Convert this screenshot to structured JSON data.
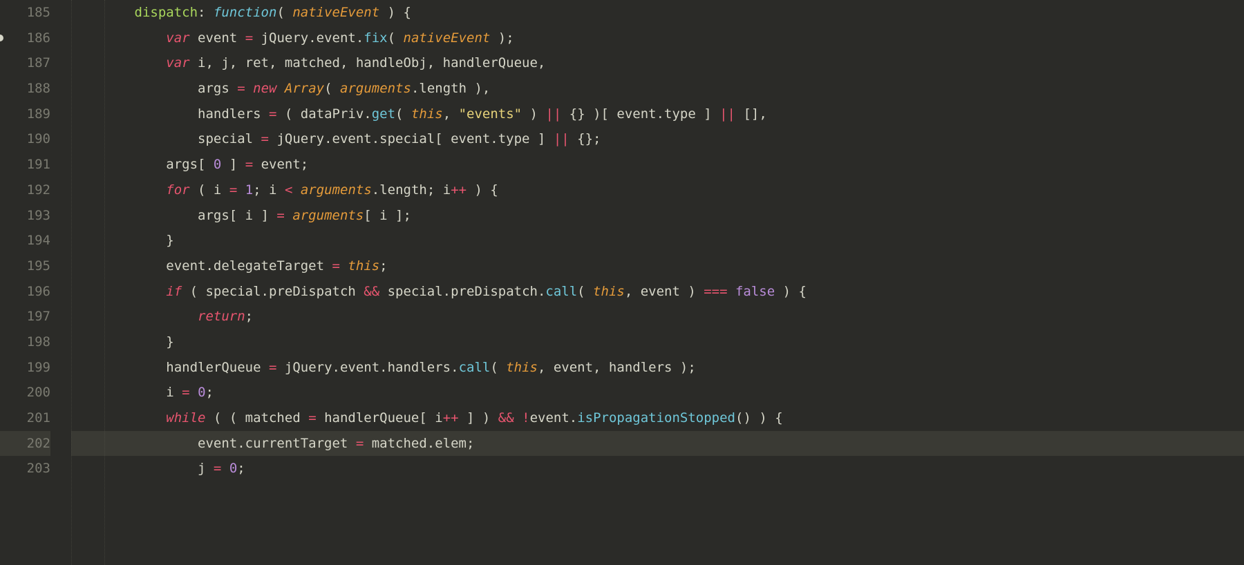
{
  "gutter": {
    "start": 185,
    "end": 203,
    "modified_lines": [
      186
    ],
    "current_line": 202
  },
  "code": {
    "lines": [
      {
        "n": 185,
        "indent": 2,
        "tokens": [
          [
            "def",
            "dispatch"
          ],
          [
            "pu",
            ": "
          ],
          [
            "fn",
            "function"
          ],
          [
            "pu",
            "( "
          ],
          [
            "par",
            "nativeEvent"
          ],
          [
            "pu",
            " ) {"
          ]
        ]
      },
      {
        "n": 186,
        "indent": 3,
        "tokens": [
          [
            "kw",
            "var"
          ],
          [
            "pl",
            " event "
          ],
          [
            "op",
            "="
          ],
          [
            "pl",
            " jQuery.event."
          ],
          [
            "fnn",
            "fix"
          ],
          [
            "pu",
            "( "
          ],
          [
            "par",
            "nativeEvent"
          ],
          [
            "pu",
            " );"
          ]
        ]
      },
      {
        "n": 187,
        "indent": 3,
        "tokens": [
          [
            "kw",
            "var"
          ],
          [
            "pl",
            " i, j, ret, matched, handleObj, handlerQueue,"
          ]
        ]
      },
      {
        "n": 188,
        "indent": 4,
        "tokens": [
          [
            "pl",
            "args "
          ],
          [
            "op",
            "="
          ],
          [
            "pl",
            " "
          ],
          [
            "kw",
            "new"
          ],
          [
            "pl",
            " "
          ],
          [
            "par",
            "Array"
          ],
          [
            "pu",
            "( "
          ],
          [
            "par",
            "arguments"
          ],
          [
            "pl",
            ".length ),"
          ]
        ]
      },
      {
        "n": 189,
        "indent": 4,
        "tokens": [
          [
            "pl",
            "handlers "
          ],
          [
            "op",
            "="
          ],
          [
            "pl",
            " ( dataPriv."
          ],
          [
            "fnn",
            "get"
          ],
          [
            "pu",
            "( "
          ],
          [
            "par",
            "this"
          ],
          [
            "pu",
            ", "
          ],
          [
            "str",
            "\"events\""
          ],
          [
            "pu",
            " ) "
          ],
          [
            "op",
            "||"
          ],
          [
            "pu",
            " {} )[ event.type ] "
          ],
          [
            "op",
            "||"
          ],
          [
            "pu",
            " [],"
          ]
        ]
      },
      {
        "n": 190,
        "indent": 4,
        "tokens": [
          [
            "pl",
            "special "
          ],
          [
            "op",
            "="
          ],
          [
            "pl",
            " jQuery.event.special[ event.type ] "
          ],
          [
            "op",
            "||"
          ],
          [
            "pl",
            " {};"
          ]
        ]
      },
      {
        "n": 191,
        "indent": 3,
        "tokens": [
          [
            "pl",
            "args[ "
          ],
          [
            "num",
            "0"
          ],
          [
            "pl",
            " ] "
          ],
          [
            "op",
            "="
          ],
          [
            "pl",
            " event;"
          ]
        ]
      },
      {
        "n": 192,
        "indent": 3,
        "tokens": [
          [
            "kw",
            "for"
          ],
          [
            "pu",
            " ( i "
          ],
          [
            "op",
            "="
          ],
          [
            "pu",
            " "
          ],
          [
            "num",
            "1"
          ],
          [
            "pu",
            "; i "
          ],
          [
            "op",
            "<"
          ],
          [
            "pu",
            " "
          ],
          [
            "par",
            "arguments"
          ],
          [
            "pl",
            ".length; i"
          ],
          [
            "op",
            "++"
          ],
          [
            "pu",
            " ) {"
          ]
        ]
      },
      {
        "n": 193,
        "indent": 4,
        "tokens": [
          [
            "pl",
            "args[ i ] "
          ],
          [
            "op",
            "="
          ],
          [
            "pl",
            " "
          ],
          [
            "par",
            "arguments"
          ],
          [
            "pl",
            "[ i ];"
          ]
        ]
      },
      {
        "n": 194,
        "indent": 3,
        "tokens": [
          [
            "pu",
            "}"
          ]
        ]
      },
      {
        "n": 195,
        "indent": 3,
        "tokens": [
          [
            "pl",
            "event.delegateTarget "
          ],
          [
            "op",
            "="
          ],
          [
            "pl",
            " "
          ],
          [
            "par",
            "this"
          ],
          [
            "pu",
            ";"
          ]
        ]
      },
      {
        "n": 196,
        "indent": 3,
        "tokens": [
          [
            "kw",
            "if"
          ],
          [
            "pu",
            " ( special.preDispatch "
          ],
          [
            "op",
            "&&"
          ],
          [
            "pu",
            " special.preDispatch."
          ],
          [
            "fnn",
            "call"
          ],
          [
            "pu",
            "( "
          ],
          [
            "par",
            "this"
          ],
          [
            "pu",
            ", event ) "
          ],
          [
            "op",
            "==="
          ],
          [
            "pu",
            " "
          ],
          [
            "bool",
            "false"
          ],
          [
            "pu",
            " ) {"
          ]
        ]
      },
      {
        "n": 197,
        "indent": 4,
        "tokens": [
          [
            "kw",
            "return"
          ],
          [
            "pu",
            ";"
          ]
        ]
      },
      {
        "n": 198,
        "indent": 3,
        "tokens": [
          [
            "pu",
            "}"
          ]
        ]
      },
      {
        "n": 199,
        "indent": 3,
        "tokens": [
          [
            "pl",
            "handlerQueue "
          ],
          [
            "op",
            "="
          ],
          [
            "pl",
            " jQuery.event.handlers."
          ],
          [
            "fnn",
            "call"
          ],
          [
            "pu",
            "( "
          ],
          [
            "par",
            "this"
          ],
          [
            "pu",
            ", event, handlers );"
          ]
        ]
      },
      {
        "n": 200,
        "indent": 3,
        "tokens": [
          [
            "pl",
            "i "
          ],
          [
            "op",
            "="
          ],
          [
            "pl",
            " "
          ],
          [
            "num",
            "0"
          ],
          [
            "pu",
            ";"
          ]
        ]
      },
      {
        "n": 201,
        "indent": 3,
        "tokens": [
          [
            "kw",
            "while"
          ],
          [
            "pu",
            " ( ( matched "
          ],
          [
            "op",
            "="
          ],
          [
            "pu",
            " handlerQueue[ i"
          ],
          [
            "op",
            "++"
          ],
          [
            "pu",
            " ] ) "
          ],
          [
            "op",
            "&&"
          ],
          [
            "pu",
            " "
          ],
          [
            "op",
            "!"
          ],
          [
            "pl",
            "event."
          ],
          [
            "fnn",
            "isPropagationStopped"
          ],
          [
            "pu",
            "() ) {"
          ]
        ]
      },
      {
        "n": 202,
        "indent": 4,
        "tokens": [
          [
            "pl",
            "event.currentTarget "
          ],
          [
            "op",
            "="
          ],
          [
            "pl",
            " matched.elem;"
          ]
        ]
      },
      {
        "n": 203,
        "indent": 4,
        "tokens": [
          [
            "pl",
            "j "
          ],
          [
            "op",
            "="
          ],
          [
            "pl",
            " "
          ],
          [
            "num",
            "0"
          ],
          [
            "pu",
            ";"
          ]
        ]
      }
    ]
  }
}
